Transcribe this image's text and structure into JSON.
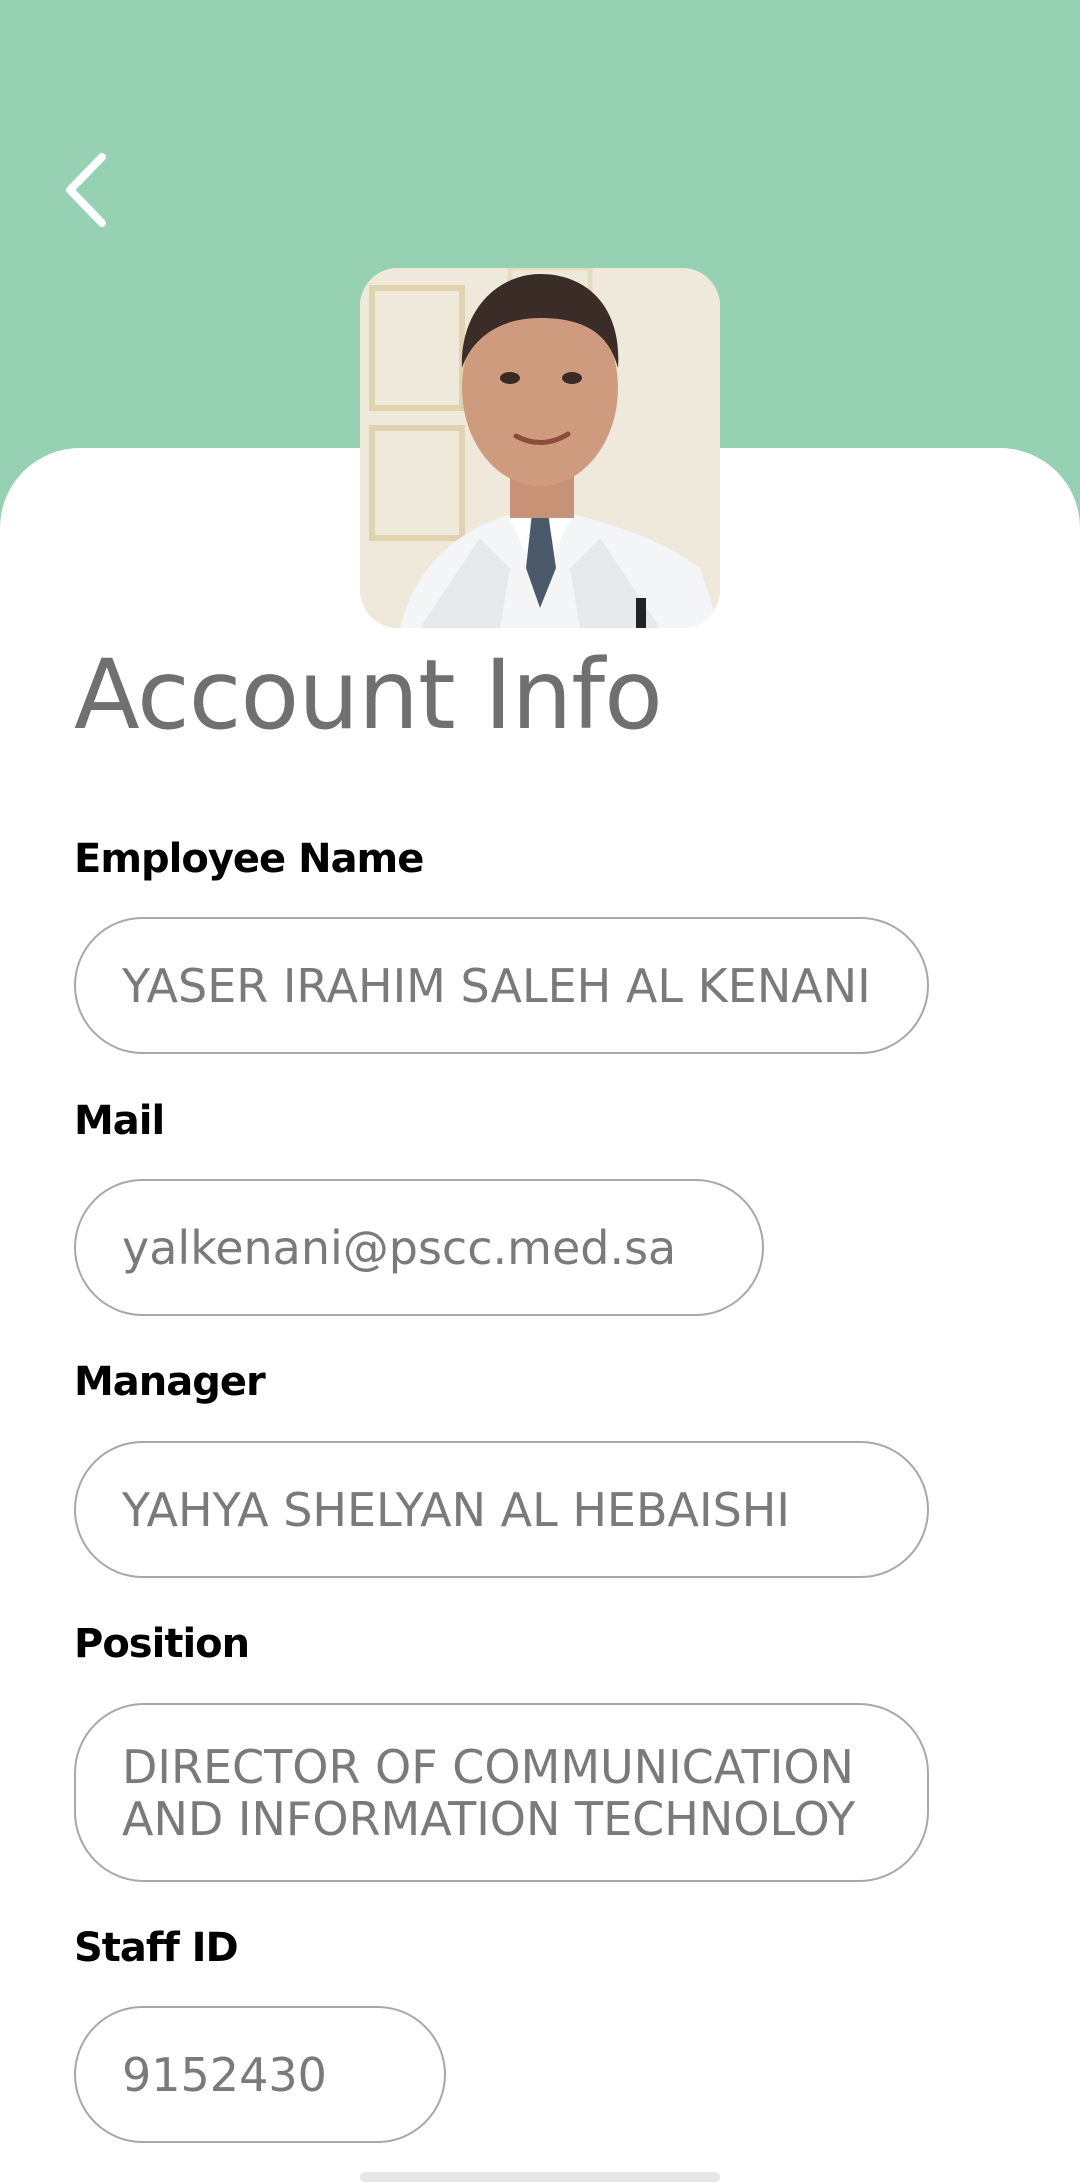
{
  "header": {
    "back_icon": "chevron-left-icon",
    "background_color": "#97d1b3"
  },
  "profile": {
    "avatar_description": "employee-photo"
  },
  "page": {
    "title": "Account Info"
  },
  "fields": {
    "employee_name": {
      "label": "Employee Name",
      "value": "YASER IRAHIM SALEH AL KENANI"
    },
    "mail": {
      "label": "Mail",
      "value": "yalkenani@pscc.med.sa"
    },
    "manager": {
      "label": "Manager",
      "value": "YAHYA SHELYAN AL HEBAISHI"
    },
    "position": {
      "label": "Position",
      "value": "DIRECTOR OF COMMUNICATION AND INFORMATION TECHNOLOY"
    },
    "staff_id": {
      "label": "Staff ID",
      "value": "9152430"
    }
  },
  "colors": {
    "accent": "#97d1b3",
    "title_text": "#707070",
    "value_text": "#7a7a7a",
    "field_border": "#a8a8a8"
  }
}
